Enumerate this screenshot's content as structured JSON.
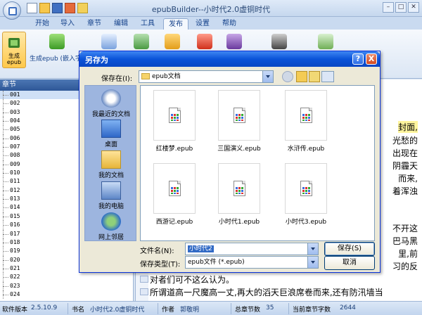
{
  "app": {
    "title": "epubBuilder--小时代2.0虚铜时代"
  },
  "ribbon": {
    "tabs": [
      "开始",
      "导入",
      "章节",
      "编辑",
      "工具",
      "发布",
      "设置",
      "帮助"
    ],
    "active_tab": "发布",
    "build_button_label_1": "生成",
    "build_button_label_2": "epub",
    "build_epub_embed_label": "生成epub (嵌入字体"
  },
  "chapters": {
    "header": "章节",
    "items": [
      "001",
      "002",
      "003",
      "004",
      "005",
      "006",
      "007",
      "008",
      "009",
      "010",
      "011",
      "012",
      "013",
      "014",
      "015",
      "016",
      "017",
      "018",
      "019",
      "020",
      "021",
      "022",
      "023",
      "024"
    ]
  },
  "editor": {
    "right_fragments": [
      "封面,",
      "光愁的",
      "出现在",
      "阴霾天",
      "而来,",
      "着浑浊",
      "不开这",
      "巴马黑",
      "里,前",
      "习的反"
    ],
    "bottom_lines": [
      "对者们可不这么认为。",
      "所谓道高一尺魔高一丈,再大的滔天巨浪席卷而来,还有防汛墙当"
    ]
  },
  "status": {
    "version_label": "软件版本",
    "version_value": "2.5.10.9",
    "book_label": "书名",
    "book_value": "小时代2.0虚铜时代",
    "author_label": "作者",
    "author_value": "郭敬明",
    "chapters_label": "总章节数",
    "chapters_value": "35",
    "chars_label": "当前章节字数",
    "chars_value": "2644"
  },
  "dialog": {
    "title": "另存为",
    "help_btn": "?",
    "close_btn": "X",
    "save_in_label": "保存在(I):",
    "save_in_value": "epub文档",
    "places": [
      "我最近的文档",
      "桌面",
      "我的文档",
      "我的电脑",
      "网上邻居"
    ],
    "files": [
      "红楼梦.epub",
      "三国演义.epub",
      "水浒传.epub",
      "西游记.epub",
      "小时代1.epub",
      "小时代3.epub"
    ],
    "filename_label": "文件名(N):",
    "filename_value": "小时代2",
    "filetype_label": "保存类型(T):",
    "filetype_value": "epub文件 (*.epub)",
    "save_button": "保存(S)",
    "cancel_button": "取消"
  },
  "colors": {
    "dialog_title": "#0a53d8",
    "ribbon_bg": "#dbe6f4",
    "highlight": "#fff59d"
  }
}
